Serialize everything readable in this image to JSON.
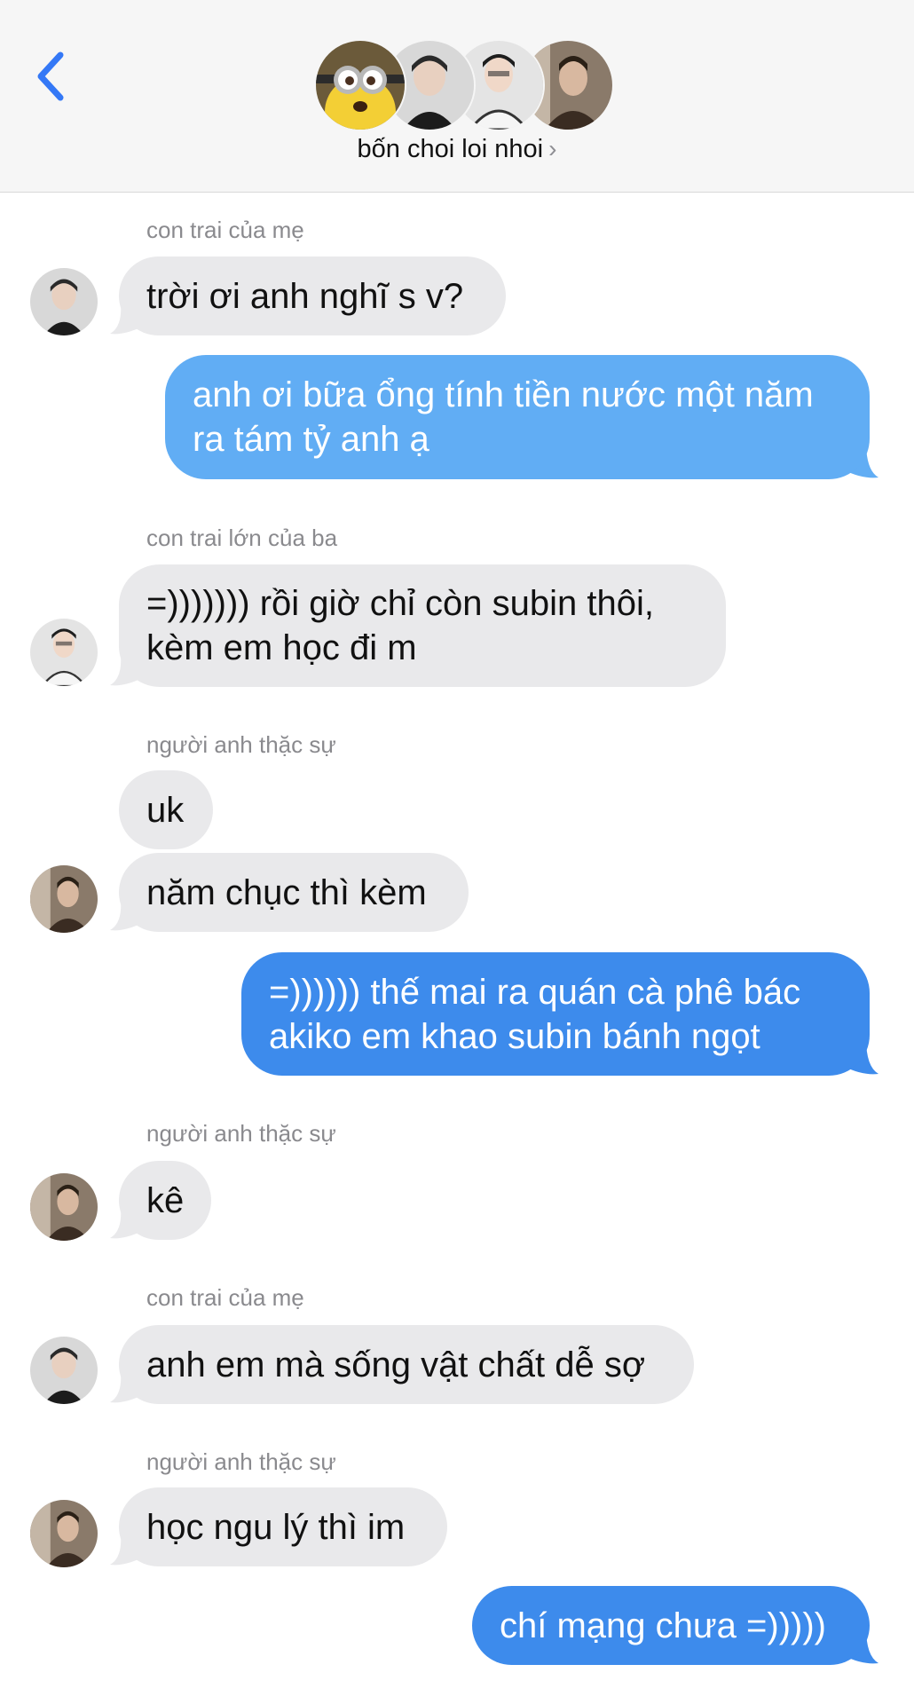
{
  "header": {
    "back_icon": "chevron-left-icon",
    "group_name": "bốn choi loi nhoi",
    "accent": "#3478f6"
  },
  "colors": {
    "received_bubble": "#e9e9eb",
    "sent_bubble": "#61adf4",
    "sent_bubble_latest": "#3d8bec"
  },
  "messages": [
    {
      "sender": "con trai của mẹ",
      "text_lines": [
        "trời ơi anh nghĩ s v?"
      ]
    },
    {
      "text_lines": [
        "anh ơi bữa ổng tính tiền nước một năm",
        "ra tám tỷ anh ạ"
      ]
    },
    {
      "sender": "con trai lớn của ba",
      "text_lines": [
        "=))))))) rồi giờ chỉ còn subin thôi,",
        "kèm em học đi m"
      ]
    },
    {
      "sender": "người anh thặc sự",
      "text_lines": [
        "uk"
      ]
    },
    {
      "text_lines": [
        "năm chục thì kèm"
      ]
    },
    {
      "text_lines": [
        "=)))))) thế mai ra quán cà phê bác",
        "akiko em khao subin bánh ngọt"
      ]
    },
    {
      "sender": "người anh thặc sự",
      "text_lines": [
        "kê"
      ]
    },
    {
      "sender": "con trai của mẹ",
      "text_lines": [
        "anh em mà sống vật chất dễ sợ"
      ]
    },
    {
      "sender": "người anh thặc sự",
      "text_lines": [
        "học ngu lý thì im"
      ]
    },
    {
      "text_lines": [
        "chí mạng chưa =)))))"
      ]
    }
  ]
}
